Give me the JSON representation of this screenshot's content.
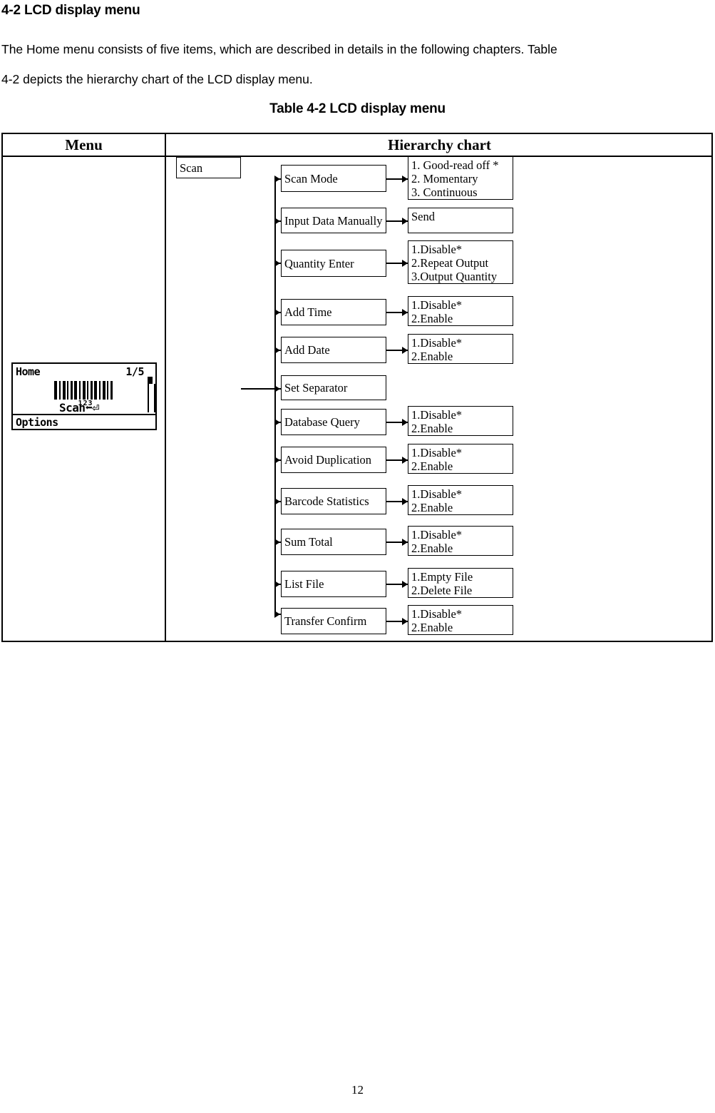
{
  "document": {
    "section_heading": "4-2 LCD display menu",
    "paragraph_line1": "The Home menu consists of five items, which are described in details in the following chapters. Table",
    "paragraph_line2": "4-2 depicts the hierarchy chart of the LCD display menu.",
    "table_caption": "Table 4-2 LCD display menu",
    "page_number": "12"
  },
  "table": {
    "headers": {
      "menu": "Menu",
      "hierarchy": "Hierarchy chart"
    }
  },
  "lcd": {
    "title": "Home",
    "page_indicator": "1/5",
    "barcode_number": "123",
    "scan_label": "Scan",
    "return_glyph": "⬅⏎",
    "options_label": "Options"
  },
  "hierarchy": {
    "root": "Scan",
    "items": [
      {
        "name": "Scan Mode",
        "options": [
          "1. Good-read off *",
          "2. Momentary",
          "3. Continuous"
        ]
      },
      {
        "name": "Input Data Manually",
        "options": [
          "Send"
        ]
      },
      {
        "name": "Quantity Enter",
        "options": [
          "1.Disable*",
          "2.Repeat Output",
          "3.Output Quantity"
        ]
      },
      {
        "name": "Add Time",
        "options": [
          "1.Disable*",
          "2.Enable"
        ]
      },
      {
        "name": "Add Date",
        "options": [
          "1.Disable*",
          "2.Enable"
        ]
      },
      {
        "name": "Set Separator",
        "options": []
      },
      {
        "name": "Database Query",
        "options": [
          "1.Disable*",
          "2.Enable"
        ]
      },
      {
        "name": "Avoid Duplication",
        "options": [
          "1.Disable*",
          "2.Enable"
        ]
      },
      {
        "name": "Barcode Statistics",
        "options": [
          "1.Disable*",
          "2.Enable"
        ]
      },
      {
        "name": "Sum Total",
        "options": [
          "1.Disable*",
          "2.Enable"
        ]
      },
      {
        "name": "List File",
        "options": [
          "1.Empty File",
          "2.Delete File"
        ]
      },
      {
        "name": "Transfer Confirm",
        "options": [
          "1.Disable*",
          "2.Enable"
        ]
      }
    ]
  }
}
